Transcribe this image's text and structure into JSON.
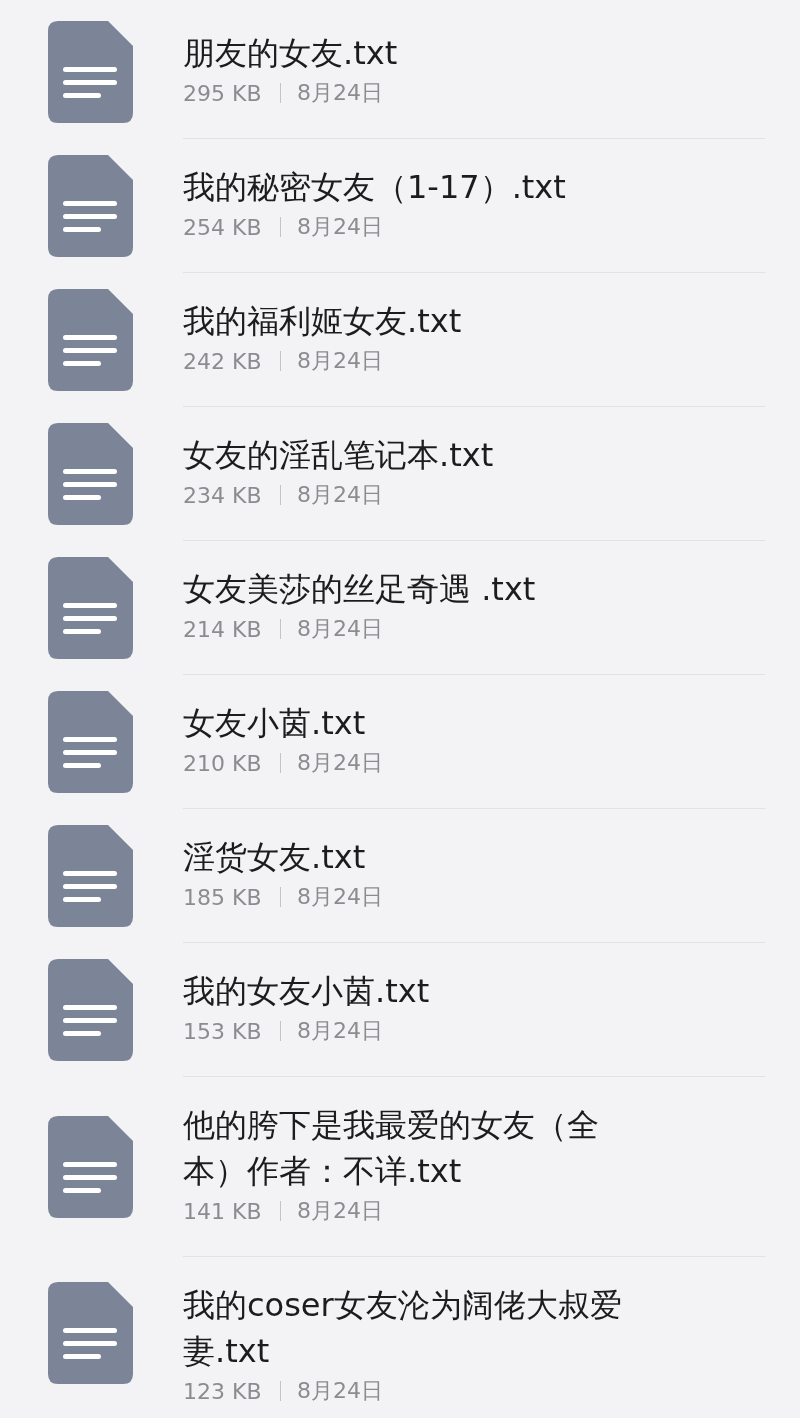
{
  "files": [
    {
      "title_lines": [
        "朋友的女友.txt"
      ],
      "size": "295 KB",
      "date": "8月24日"
    },
    {
      "title_lines": [
        "我的秘密女友（1-17）.txt"
      ],
      "size": "254 KB",
      "date": "8月24日"
    },
    {
      "title_lines": [
        "我的福利姬女友.txt"
      ],
      "size": "242 KB",
      "date": "8月24日"
    },
    {
      "title_lines": [
        "女友的淫乱笔记本.txt"
      ],
      "size": "234 KB",
      "date": "8月24日"
    },
    {
      "title_lines": [
        "女友美莎的丝足奇遇  .txt"
      ],
      "size": "214 KB",
      "date": "8月24日"
    },
    {
      "title_lines": [
        "女友小茵.txt"
      ],
      "size": "210 KB",
      "date": "8月24日"
    },
    {
      "title_lines": [
        "淫货女友.txt"
      ],
      "size": "185 KB",
      "date": "8月24日"
    },
    {
      "title_lines": [
        "我的女友小茵.txt"
      ],
      "size": "153 KB",
      "date": "8月24日"
    },
    {
      "title_lines": [
        "他的胯下是我最爱的女友（全",
        "本）作者：不详.txt"
      ],
      "size": "141 KB",
      "date": "8月24日"
    },
    {
      "title_lines": [
        "我的coser女友沦为阔佬大叔爱",
        "妻.txt"
      ],
      "size": "123 KB",
      "date": "8月24日"
    }
  ]
}
